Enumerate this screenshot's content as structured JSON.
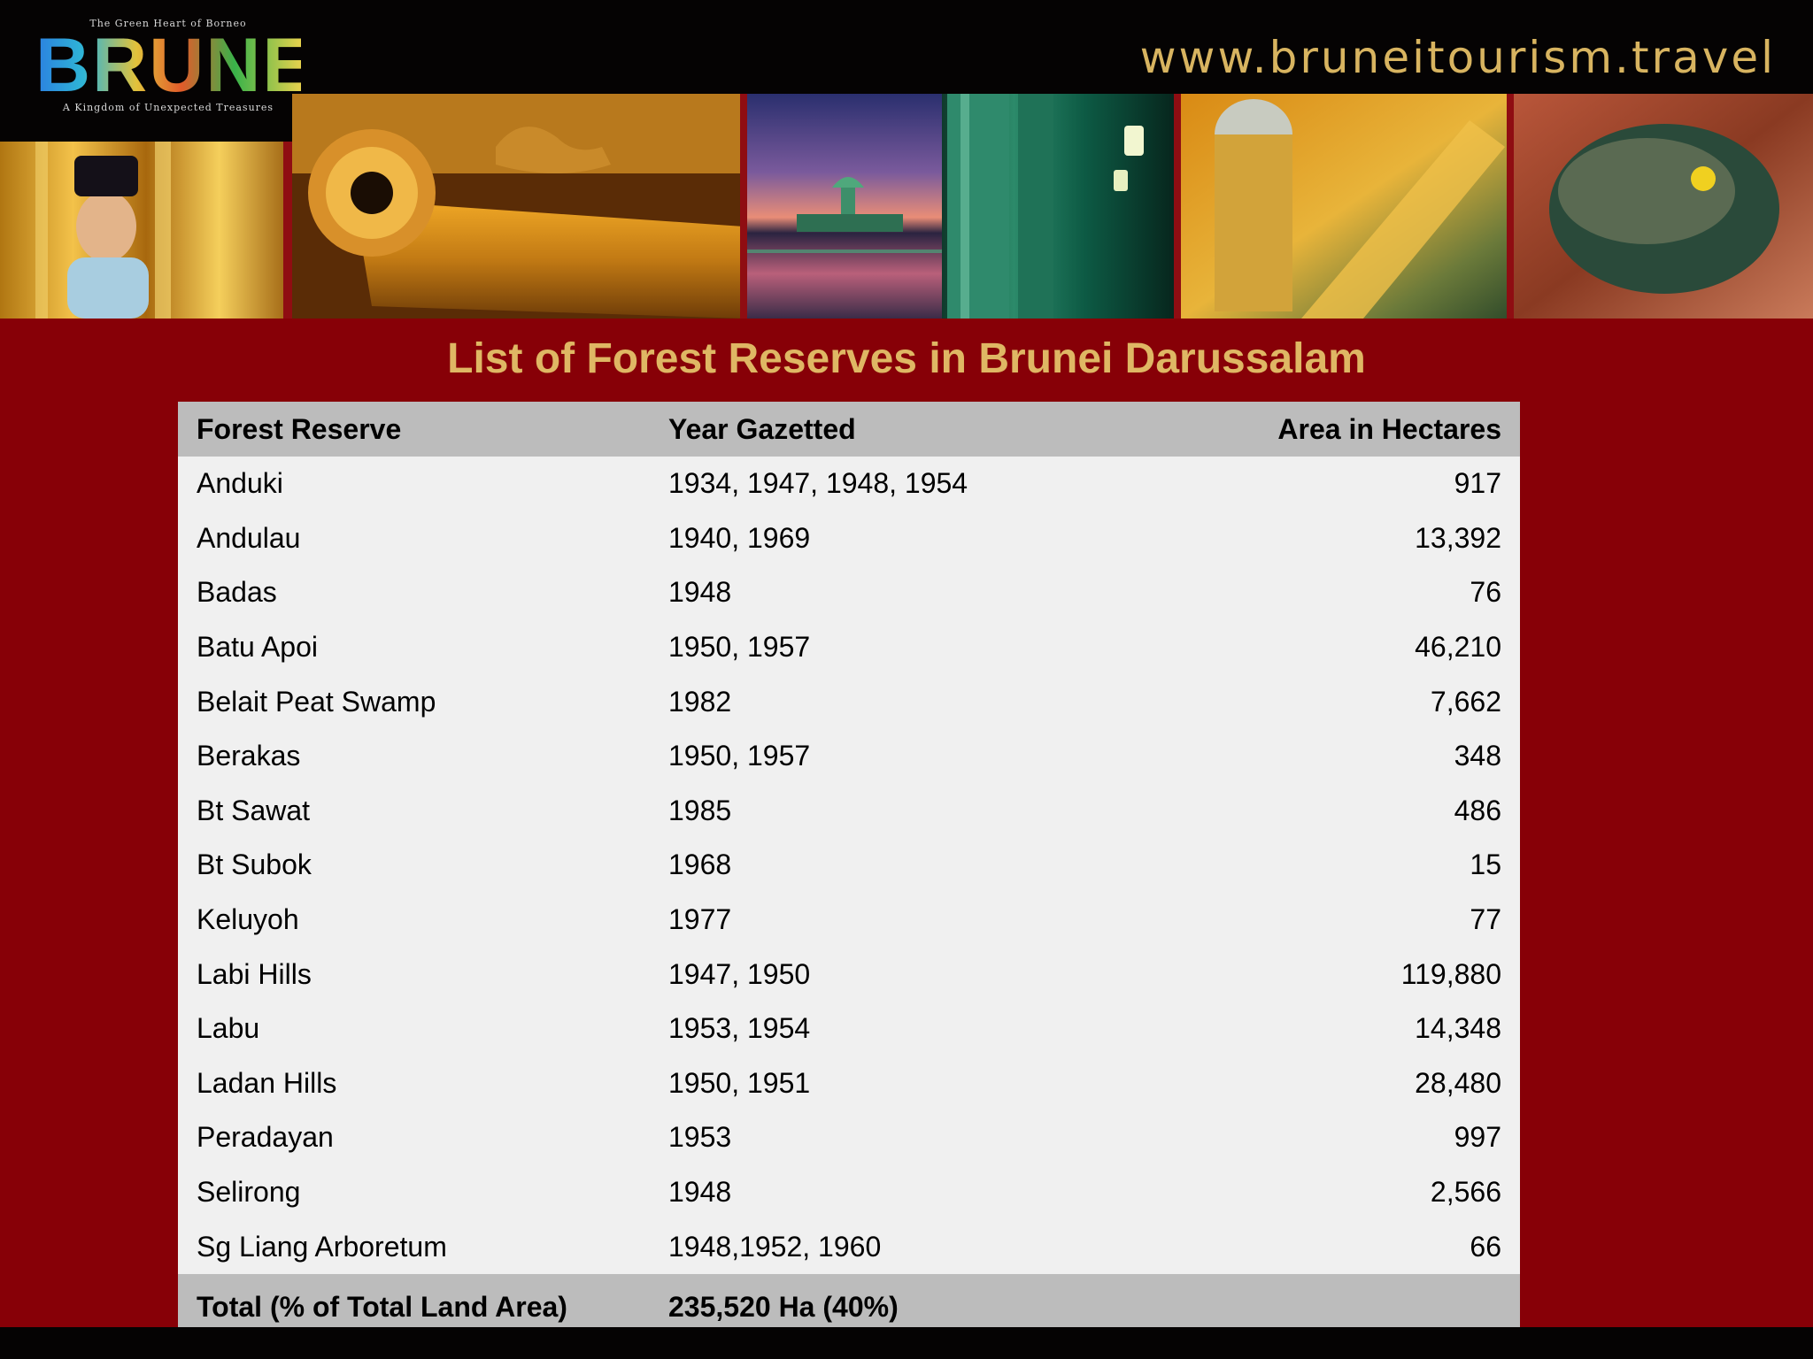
{
  "header": {
    "logo": {
      "tag_top": "The Green Heart of Borneo",
      "wordmark": "BRUNEI",
      "tag_bottom": "A Kingdom of Unexpected Treasures"
    },
    "website": "www.bruneitourism.travel"
  },
  "photos": [
    {
      "name": "boy-with-golden-columns-photo"
    },
    {
      "name": "brass-cannon-photo"
    },
    {
      "name": "mosque-at-sunset-photo"
    },
    {
      "name": "green-columns-lantern-photo"
    },
    {
      "name": "golden-songket-fabric-photo"
    },
    {
      "name": "rock-with-yellow-flower-photo"
    }
  ],
  "title": "List of Forest Reserves in Brunei Darussalam",
  "table": {
    "headers": [
      "Forest Reserve",
      "Year Gazetted",
      "Area in Hectares"
    ],
    "rows": [
      [
        "Anduki",
        "1934, 1947, 1948, 1954",
        "917"
      ],
      [
        "Andulau",
        "1940, 1969",
        "13,392"
      ],
      [
        "Badas",
        "1948",
        "76"
      ],
      [
        "Batu Apoi",
        "1950, 1957",
        "46,210"
      ],
      [
        "Belait Peat Swamp",
        "1982",
        "7,662"
      ],
      [
        "Berakas",
        "1950, 1957",
        "348"
      ],
      [
        "Bt Sawat",
        "1985",
        "486"
      ],
      [
        "Bt Subok",
        "1968",
        "15"
      ],
      [
        "Keluyoh",
        "1977",
        "77"
      ],
      [
        "Labi Hills",
        "1947, 1950",
        "119,880"
      ],
      [
        "Labu",
        "1953, 1954",
        "14,348"
      ],
      [
        "Ladan Hills",
        "1950, 1951",
        "28,480"
      ],
      [
        "Peradayan",
        "1953",
        "997"
      ],
      [
        "Selirong",
        "1948",
        "2,566"
      ],
      [
        "Sg Liang Arboretum",
        "1948,1952, 1960",
        "66"
      ]
    ],
    "total": {
      "label": "Total (% of Total Land Area)",
      "value": "235,520 Ha (40%)"
    }
  },
  "colors": {
    "background": "#870007",
    "header": "#050303",
    "title": "#dfb764",
    "table_header": "#bcbcbc",
    "table_body": "#f0f0f0"
  }
}
